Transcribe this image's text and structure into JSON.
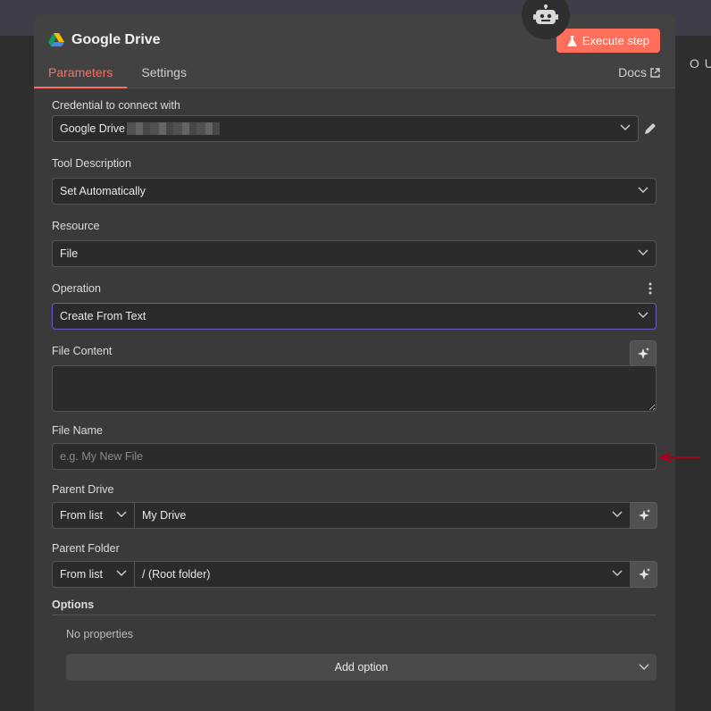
{
  "header": {
    "title": "Google Drive",
    "execute_label": "Execute step",
    "tabs": [
      {
        "label": "Parameters"
      },
      {
        "label": "Settings"
      }
    ],
    "docs_label": "Docs"
  },
  "side": {
    "output_label": "O U"
  },
  "form": {
    "credential": {
      "label": "Credential to connect with",
      "value": "Google Drive"
    },
    "tool_description": {
      "label": "Tool Description",
      "value": "Set Automatically"
    },
    "resource": {
      "label": "Resource",
      "value": "File"
    },
    "operation": {
      "label": "Operation",
      "value": "Create From Text"
    },
    "file_content": {
      "label": "File Content"
    },
    "file_name": {
      "label": "File Name",
      "placeholder": "e.g. My New File"
    },
    "parent_drive": {
      "label": "Parent Drive",
      "mode": "From list",
      "value": "My Drive"
    },
    "parent_folder": {
      "label": "Parent Folder",
      "mode": "From list",
      "value": "/ (Root folder)"
    },
    "options": {
      "label": "Options",
      "empty_text": "No properties",
      "add_label": "Add option"
    }
  },
  "colors": {
    "accent": "#ff6f5c",
    "focus": "#6a5cc7",
    "annotation_arrow": "#a8001a"
  }
}
